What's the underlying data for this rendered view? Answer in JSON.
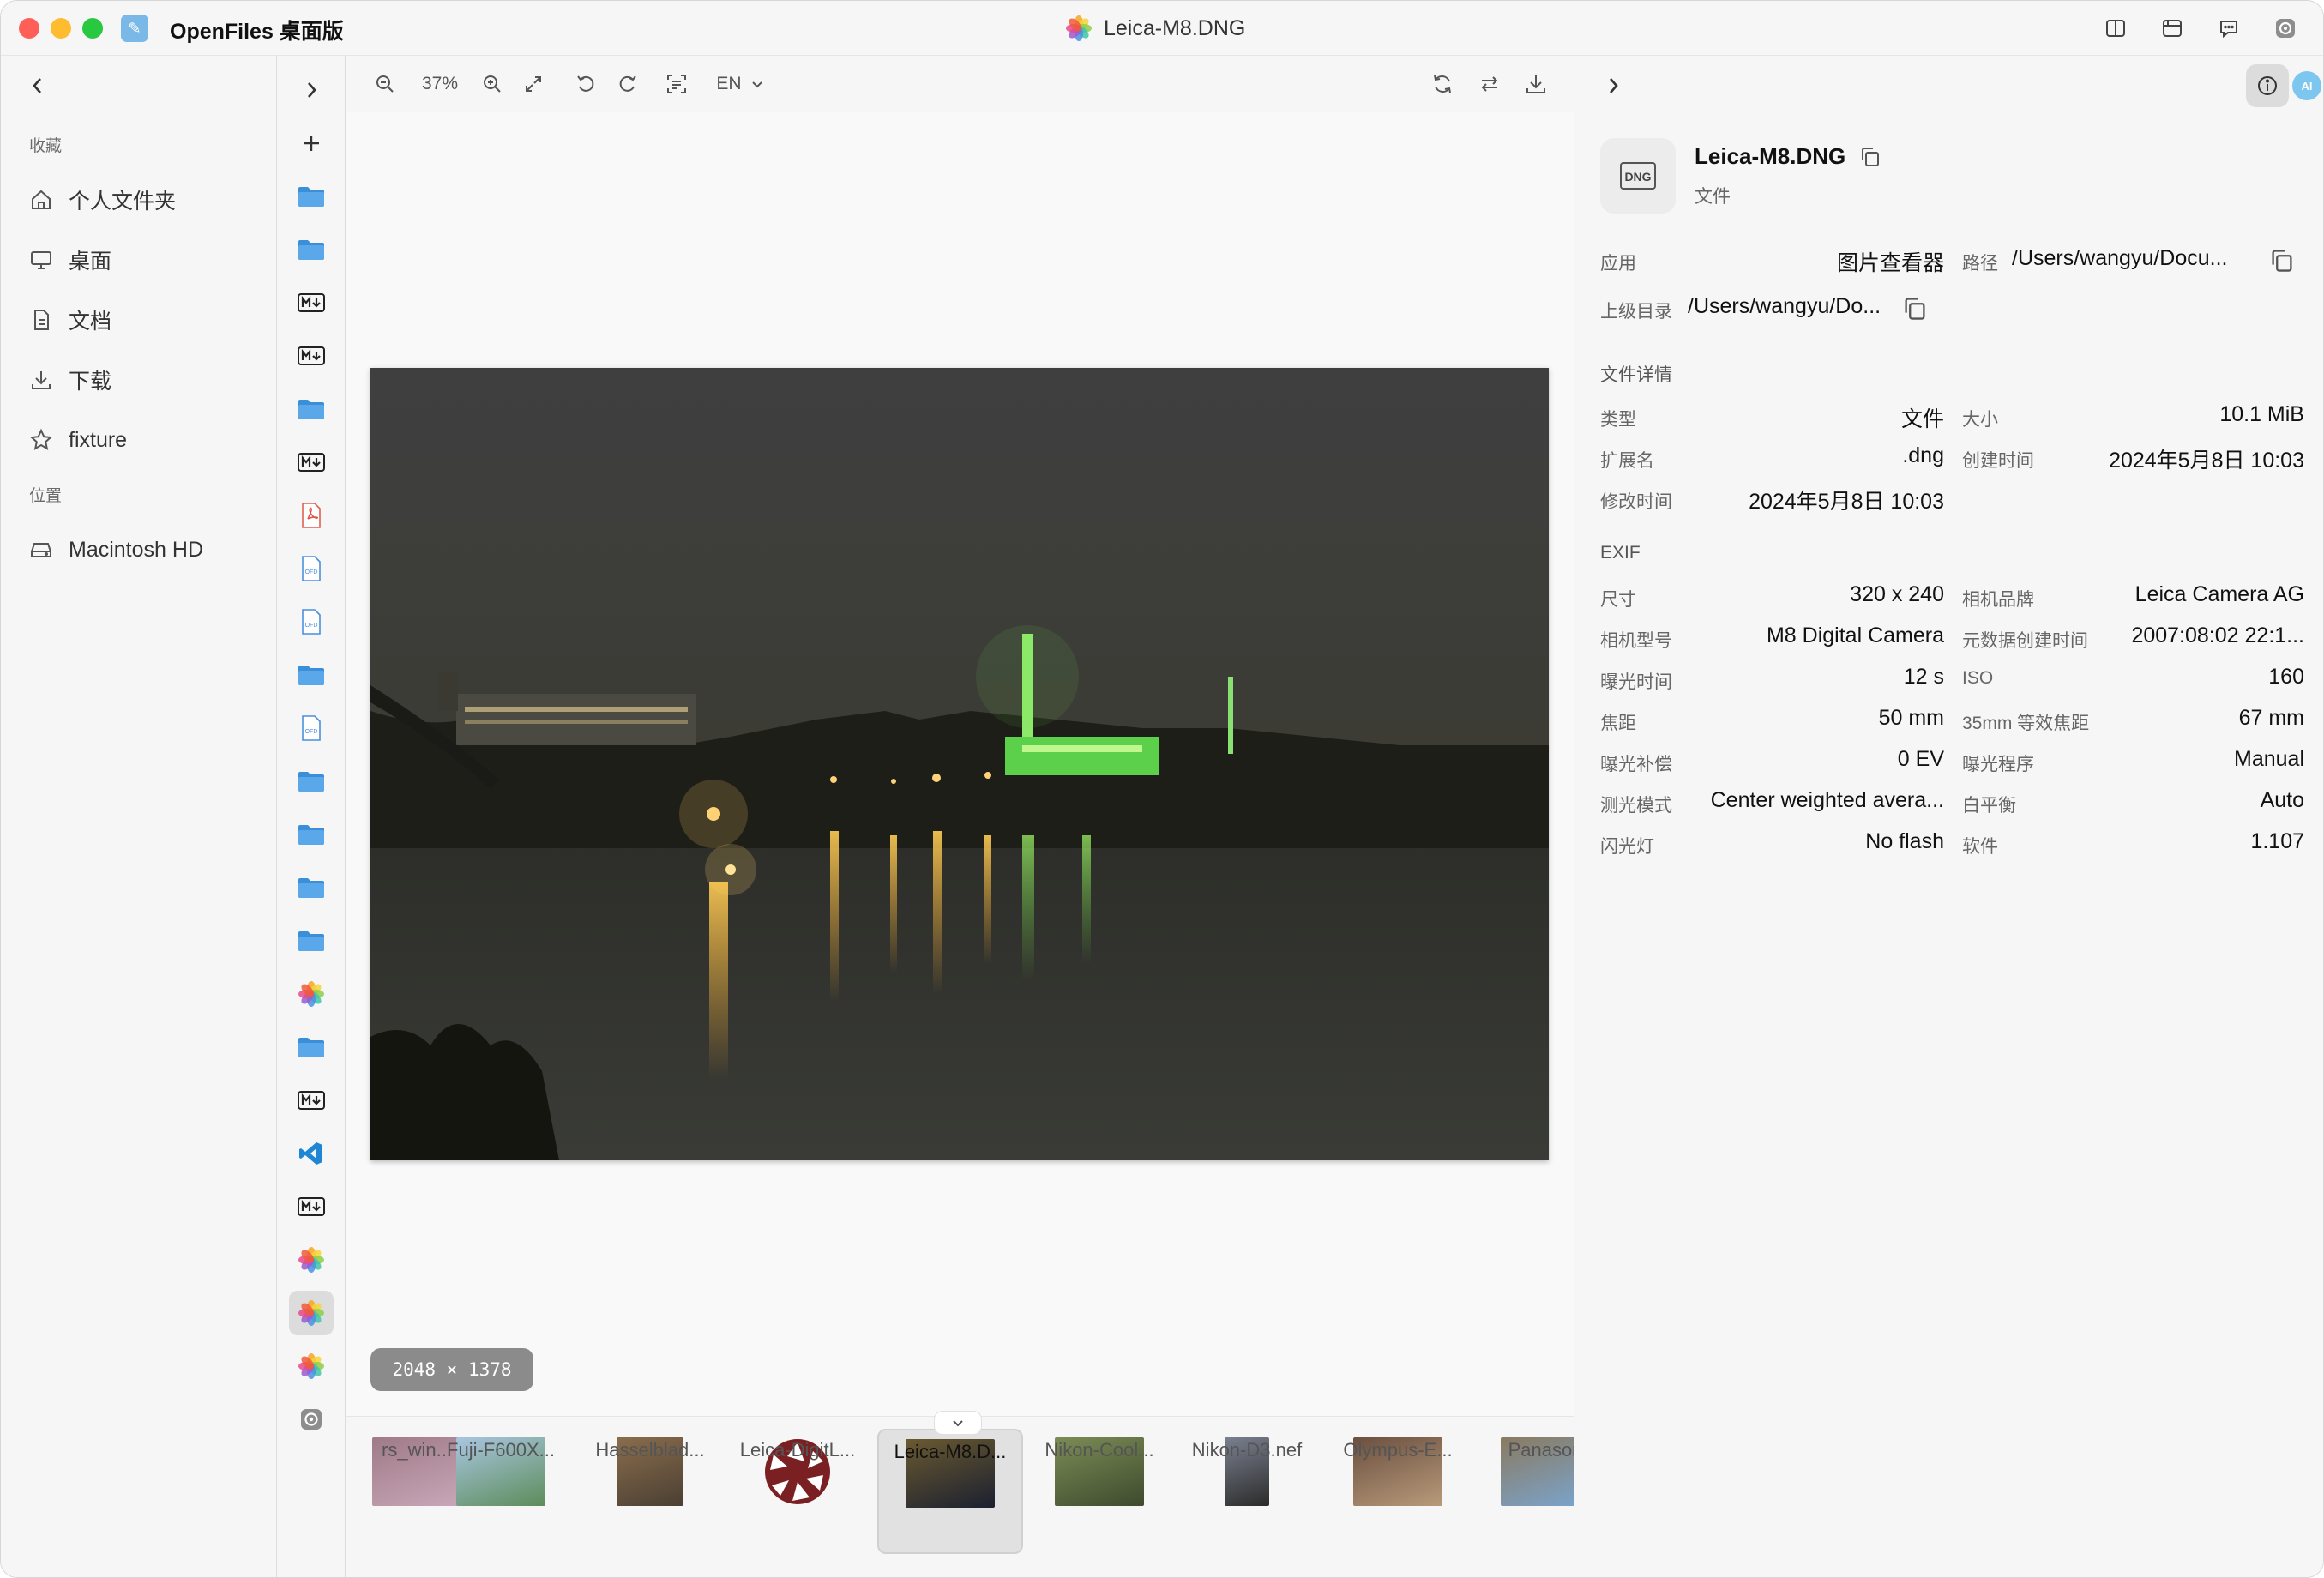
{
  "titlebar": {
    "app_title": "OpenFiles 桌面版",
    "doc_title": "Leica-M8.DNG",
    "traffic_colors": [
      "#ff5f57",
      "#febc2e",
      "#28c840"
    ]
  },
  "sidebar": {
    "favorites_title": "收藏",
    "favorites": [
      {
        "label": "个人文件夹",
        "icon": "home-icon"
      },
      {
        "label": "桌面",
        "icon": "monitor-icon"
      },
      {
        "label": "文档",
        "icon": "document-icon"
      },
      {
        "label": "下载",
        "icon": "download-icon"
      },
      {
        "label": "fixture",
        "icon": "star-icon"
      }
    ],
    "locations_title": "位置",
    "locations": [
      {
        "label": "Macintosh HD",
        "icon": "drive-icon"
      }
    ]
  },
  "iconcol": {
    "items": [
      "plus",
      "folder",
      "folder",
      "markdown",
      "markdown",
      "folder",
      "markdown",
      "pdf",
      "ofd",
      "ofd",
      "folder",
      "ofd",
      "folder",
      "folder",
      "folder",
      "folder",
      "photos",
      "folder",
      "markdown",
      "vscode",
      "markdown",
      "photos",
      "photos",
      "photos",
      "settings"
    ],
    "selected_index": 22
  },
  "viewer": {
    "zoom": "37%",
    "lang": "EN",
    "dimensions": "2048 × 1378",
    "thumbnails": [
      {
        "label": "rs_win..."
      },
      {
        "label": "Fuji-F600X..."
      },
      {
        "label": "Hasselblad..."
      },
      {
        "label": "Leica-DigitL..."
      },
      {
        "label": "Leica-M8.D...",
        "selected": true
      },
      {
        "label": "Nikon-Cool..."
      },
      {
        "label": "Nikon-D3.nef"
      },
      {
        "label": "Olympus-E..."
      },
      {
        "label": "Panason"
      }
    ]
  },
  "panel": {
    "file_name": "Leica-M8.DNG",
    "file_kind": "文件",
    "file_badge": "DNG",
    "app_label": "应用",
    "app_value": "图片查看器",
    "path_label": "路径",
    "path_value": "/Users/wangyu/Docu...",
    "parent_label": "上级目录",
    "parent_value": "/Users/wangyu/Do...",
    "details_title": "文件详情",
    "details": [
      {
        "label": "类型",
        "value": "文件"
      },
      {
        "label": "大小",
        "value": "10.1 MiB"
      },
      {
        "label": "扩展名",
        "value": ".dng"
      },
      {
        "label": "创建时间",
        "value": "2024年5月8日 10:03"
      },
      {
        "label": "修改时间",
        "value": "2024年5月8日 10:03"
      }
    ],
    "exif_title": "EXIF",
    "exif": [
      {
        "label": "尺寸",
        "value": "320 x 240"
      },
      {
        "label": "相机品牌",
        "value": "Leica Camera AG"
      },
      {
        "label": "相机型号",
        "value": "M8 Digital Camera"
      },
      {
        "label": "元数据创建时间",
        "value": "2007:08:02 22:1..."
      },
      {
        "label": "曝光时间",
        "value": "12 s"
      },
      {
        "label": "ISO",
        "value": "160"
      },
      {
        "label": "焦距",
        "value": "50 mm"
      },
      {
        "label": "35mm 等效焦距",
        "value": "67 mm"
      },
      {
        "label": "曝光补偿",
        "value": "0 EV"
      },
      {
        "label": "曝光程序",
        "value": "Manual"
      },
      {
        "label": "测光模式",
        "value": "Center weighted avera..."
      },
      {
        "label": "白平衡",
        "value": "Auto"
      },
      {
        "label": "闪光灯",
        "value": "No flash"
      },
      {
        "label": "软件",
        "value": "1.107"
      }
    ],
    "ai_badge": "AI"
  }
}
